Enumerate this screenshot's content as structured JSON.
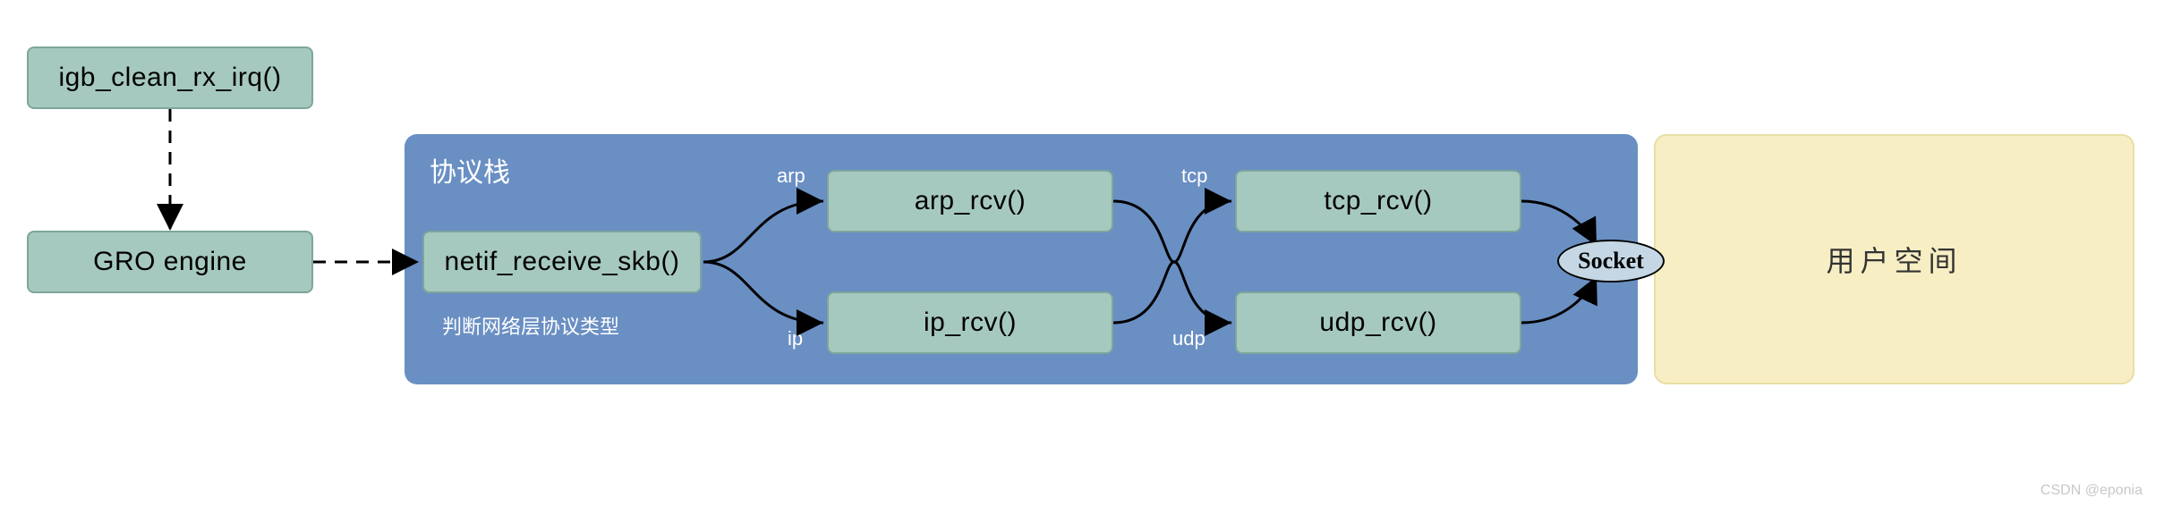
{
  "chart_data": {
    "type": "flow",
    "nodes": [
      {
        "id": "igb",
        "label": "igb_clean_rx_irq()"
      },
      {
        "id": "gro",
        "label": "GRO engine"
      },
      {
        "id": "netif",
        "label": "netif_receive_skb()"
      },
      {
        "id": "arp",
        "label": "arp_rcv()"
      },
      {
        "id": "ip",
        "label": "ip_rcv()"
      },
      {
        "id": "tcp",
        "label": "tcp_rcv()"
      },
      {
        "id": "udp",
        "label": "udp_rcv()"
      },
      {
        "id": "socket",
        "label": "Socket"
      }
    ],
    "edges": [
      {
        "from": "igb",
        "to": "gro",
        "label": "",
        "style": "dashed"
      },
      {
        "from": "gro",
        "to": "netif",
        "label": "",
        "style": "dashed"
      },
      {
        "from": "netif",
        "to": "arp",
        "label": "arp"
      },
      {
        "from": "netif",
        "to": "ip",
        "label": "ip"
      },
      {
        "from": "arp",
        "to": "tcp",
        "label": "tcp"
      },
      {
        "from": "ip",
        "to": "udp",
        "label": "udp"
      },
      {
        "from": "tcp",
        "to": "socket",
        "label": ""
      },
      {
        "from": "udp",
        "to": "socket",
        "label": ""
      }
    ],
    "clusters": [
      {
        "id": "stack",
        "label": "协议栈",
        "subtitle": "判断网络层协议类型",
        "members": [
          "netif",
          "arp",
          "ip",
          "tcp",
          "udp",
          "socket"
        ]
      },
      {
        "id": "userspace",
        "label": "用户空间",
        "members": []
      }
    ]
  },
  "labels": {
    "igb": "igb_clean_rx_irq()",
    "gro": "GRO engine",
    "netif": "netif_receive_skb()",
    "arp": "arp_rcv()",
    "ip": "ip_rcv()",
    "tcp": "tcp_rcv()",
    "udp": "udp_rcv()",
    "socket": "Socket",
    "blue_title": "协议栈",
    "blue_sub": "判断网络层协议类型",
    "yellow_title": "用户空间",
    "edge_arp": "arp",
    "edge_ip": "ip",
    "edge_tcp": "tcp",
    "edge_udp": "udp",
    "watermark": "CSDN @eponia"
  },
  "colors": {
    "node_bg": "#a6c9bf",
    "node_border": "#7da69c",
    "blue_bg": "#6a8fc3",
    "yellow_bg": "#f7eec4",
    "socket_bg": "#c5d7e4"
  }
}
